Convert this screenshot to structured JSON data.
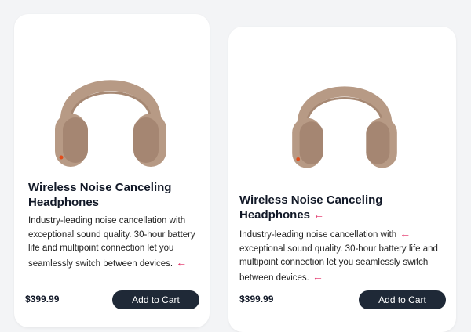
{
  "products": [
    {
      "title": "Wireless Noise Canceling Headphones",
      "description": "Industry-leading noise cancellation with exceptional sound quality. 30-hour battery life and multipoint connection let you seamlessly switch between devices.",
      "price": "$399.99",
      "button_label": "Add to Cart",
      "annotations": [
        "arrow-left-icon after description"
      ]
    },
    {
      "title": "Wireless Noise Canceling Headphones",
      "description_line1": "Industry-leading noise cancellation with",
      "description_rest": "exceptional sound quality. 30-hour battery life and multipoint connection let you seamlessly switch between devices.",
      "price": "$399.99",
      "button_label": "Add to Cart"
    }
  ],
  "colors": {
    "background": "#f3f4f6",
    "card": "#ffffff",
    "button": "#1f2937",
    "arrow": "#e0245e",
    "product": "#b79a85"
  },
  "icons": {
    "annotation_arrow": "←"
  }
}
